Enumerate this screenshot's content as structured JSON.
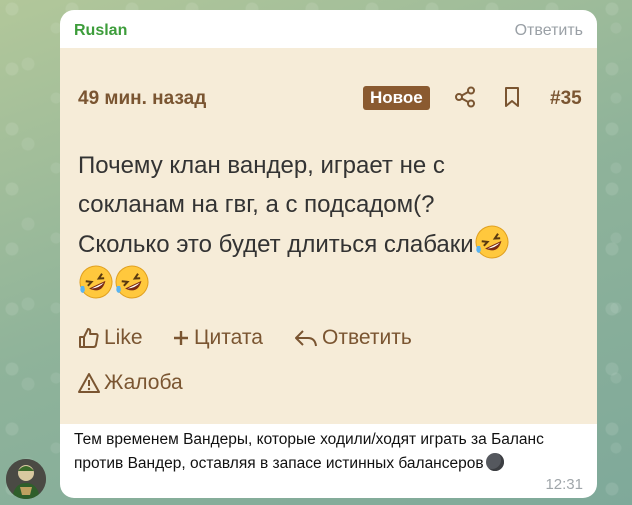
{
  "message": {
    "sender": "Ruslan",
    "reply_action": "Ответить",
    "time": "12:31",
    "text": "Тем временем Вандеры, которые ходили/ходят играть за Баланс против Вандер, оставляя в запасе истинных балансеров"
  },
  "card": {
    "time_ago": "49 мин. назад",
    "badge": "Новое",
    "number": "#35",
    "body_line1": "Почему клан вандер, играет не с",
    "body_line2": "сокланам на гвг, а с подсадом(?",
    "body_line3": "Сколько это будет длиться слабаки",
    "actions": {
      "like": "Like",
      "quote": "Цитата",
      "reply": "Ответить",
      "report": "Жалоба"
    }
  },
  "icons": {
    "share": "share-icon",
    "bookmark": "bookmark-icon",
    "laugh_emoji": "rolling-on-floor-laughing-emoji",
    "moon_emoji": "new-moon-emoji"
  },
  "colors": {
    "sender": "#3d9d3b",
    "accent_brown": "#7a5531",
    "badge_bg": "#8a5a30",
    "card_bg": "#f6ecd8"
  }
}
